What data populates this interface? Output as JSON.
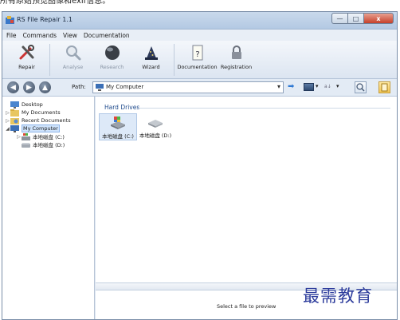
{
  "caption": "所有原始预览图像和exif信息。",
  "window": {
    "title": "RS File Repair 1.1",
    "buttons": {
      "minimize": "—",
      "maximize": "□",
      "close": "x"
    }
  },
  "menu": [
    "File",
    "Commands",
    "View",
    "Documentation"
  ],
  "toolbar": {
    "items": [
      {
        "label": "Repair",
        "icon": "repair-tools-icon",
        "enabled": true
      },
      {
        "label": "Analyse",
        "icon": "magnifier-icon",
        "enabled": false
      },
      {
        "label": "Research",
        "icon": "sphere-icon",
        "enabled": false
      },
      {
        "label": "Wizard",
        "icon": "wizard-hat-icon",
        "enabled": true
      },
      {
        "label": "Documentation",
        "icon": "document-help-icon",
        "enabled": true
      },
      {
        "label": "Registration",
        "icon": "padlock-icon",
        "enabled": true
      }
    ]
  },
  "pathbar": {
    "label": "Path:",
    "value": "My Computer",
    "dropdown_glyph": "▾",
    "go_glyph": "➡",
    "sort_glyph": "a↓"
  },
  "tree": [
    {
      "label": "Desktop",
      "expander": "",
      "icon": "desktop-icon",
      "selected": false
    },
    {
      "label": "My Documents",
      "expander": "▷",
      "icon": "folder-icon",
      "selected": false
    },
    {
      "label": "Recent Documents",
      "expander": "▷",
      "icon": "recent-documents-icon",
      "selected": false
    },
    {
      "label": "My Computer",
      "expander": "◢",
      "icon": "computer-icon",
      "selected": true
    },
    {
      "label": "本地磁盘 (C:)",
      "expander": "▷",
      "icon": "system-drive-icon",
      "selected": false
    },
    {
      "label": "本地磁盘 (D:)",
      "expander": "",
      "icon": "drive-icon",
      "selected": false
    }
  ],
  "content": {
    "group_title": "Hard Drives",
    "drives": [
      {
        "label": "本地磁盘 (C:)",
        "icon": "system-drive-icon",
        "selected": true
      },
      {
        "label": "本地磁盘 (D:)",
        "icon": "drive-icon",
        "selected": false
      }
    ]
  },
  "preview": {
    "text": "Select a file to preview"
  },
  "watermark": "最需教育",
  "colors": {
    "selection": "#cfe3fb",
    "group_title": "#1e4a8c",
    "watermark": "#2d3c9c",
    "close_button": "#c6412b"
  }
}
